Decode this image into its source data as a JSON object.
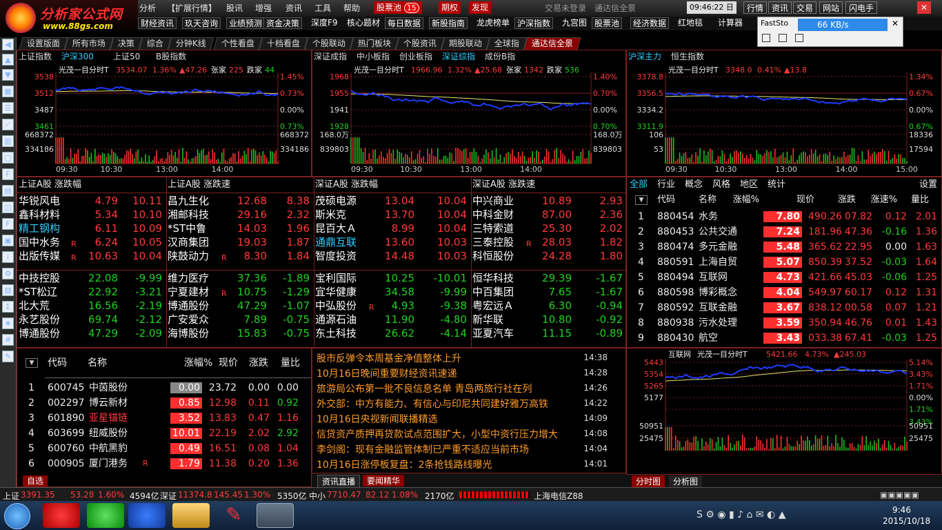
{
  "app": {
    "logo_title": "分析家公式网",
    "logo_url": "www.88gs.com"
  },
  "menu": {
    "items": [
      "分析",
      "【扩展行情】",
      "股讯",
      "增强",
      "资讯",
      "工具",
      "帮助"
    ],
    "stockpool": "股票池",
    "badge": "15",
    "qiquan": "期权",
    "fahuo": "发现",
    "login": "交易未登录",
    "quanjing": "通达信全景",
    "time": "09:46:22 日",
    "right": [
      "行情",
      "资讯",
      "交易",
      "网站",
      "闪电手"
    ]
  },
  "toolbar2": [
    "财经资讯",
    "玖天咨询",
    "业绩预测",
    "资金决策",
    "深度F9",
    "核心题材",
    "每日数据",
    "新股指南",
    "龙虎榜单",
    "沪深指数",
    "九宫图",
    "股票池",
    "经济数据",
    "红地毯",
    "计算器"
  ],
  "popup": {
    "speed": "66 KB/s",
    "app": "FastSto"
  },
  "tabs": [
    "设置版面",
    "所有市场",
    "决策",
    "综合",
    "分钟K线",
    "个性看盘",
    "十档看盘",
    "个股联动",
    "热门板块",
    "个股资讯",
    "期股联动",
    "全球指",
    "通达信全景"
  ],
  "chart1": {
    "subtabs": [
      "上证指数",
      "沪深300",
      "上证50",
      "B股指数"
    ],
    "title": "光茂一目分时T",
    "price": "3534.07",
    "pct": "1.36%",
    "chg": "▲47.26",
    "up_label": "张家",
    "up": "225",
    "down_label": "跌家",
    "down": "44",
    "ylab": [
      "3538",
      "3512",
      "3487",
      "3461",
      "668372",
      "334186"
    ],
    "rlab": [
      "1.45%",
      "0.73%",
      "0.00%",
      "0.73%",
      "668372",
      "334186"
    ],
    "xlab": [
      "09:30",
      "10:30",
      "13:00",
      "14:00"
    ]
  },
  "chart2": {
    "subtabs": [
      "深证成指",
      "中小板指",
      "创业板指",
      "深证综指",
      "成份B指"
    ],
    "title": "光茂一目分时T",
    "price": "1966.96",
    "pct": "1.32%",
    "chg": "▲25.68",
    "up_label": "张家",
    "up": "1342",
    "down_label": "跌家",
    "down": "536",
    "ylab": [
      "1968",
      "1955",
      "1941",
      "1928",
      "168.0万",
      "839803"
    ],
    "rlab": [
      "1.40%",
      "0.70%",
      "0.00%",
      "0.70%",
      "168.0万",
      "839803"
    ],
    "xlab": [
      "09:30",
      "10:30",
      "13:00",
      "14:00"
    ]
  },
  "chart3": {
    "subtabs": [
      "沪深主力",
      "恒生指数"
    ],
    "title": "光茂一目分时T",
    "price": "3348.0",
    "pct": "0.41%",
    "chg": "▲13.8",
    "ylab": [
      "3378.8",
      "3356.5",
      "3334.2",
      "3311.9",
      "106",
      "53"
    ],
    "rlab": [
      "1.34%",
      "0.67%",
      "0.00%",
      "0.67%",
      "18336",
      "17594"
    ],
    "xlab": [
      "09:30",
      "10:30",
      "13:00",
      "14:00",
      "15:00"
    ]
  },
  "chart4": {
    "title": "互联网",
    "sub": "光茂一目分时T",
    "price": "5421.66",
    "pct": "4.73%",
    "chg": "▲245.03",
    "ylab": [
      "5443",
      "5354",
      "5265",
      "5177",
      "",
      "50951",
      "25475"
    ],
    "rlab": [
      "5.14%",
      "3.43%",
      "1.71%",
      "0.00%",
      "1.71%",
      "3.43%",
      "50951",
      "25475"
    ]
  },
  "rank": {
    "headers": [
      "上证A股 涨跌幅",
      "上证A股 涨跌速",
      "深证A股 涨跌幅",
      "深证A股 涨跌速"
    ],
    "cols": [
      {
        "top": [
          [
            "华锐风电",
            "4.79",
            "10.11",
            ""
          ],
          [
            "鑫科材料",
            "5.34",
            "10.10",
            ""
          ],
          [
            "精工钢构",
            "6.11",
            "10.09",
            ""
          ],
          [
            "国中水务",
            "6.24",
            "10.05",
            "R"
          ],
          [
            "出版传媒",
            "10.63",
            "10.04",
            "R"
          ]
        ],
        "bot": [
          [
            "中技控股",
            "22.08",
            "-9.99",
            ""
          ],
          [
            "*ST松辽",
            "22.92",
            "-3.21",
            ""
          ],
          [
            "北大荒",
            "16.56",
            "-2.19",
            ""
          ],
          [
            "永艺股份",
            "69.74",
            "-2.12",
            ""
          ],
          [
            "博通股份",
            "47.29",
            "-2.09",
            ""
          ]
        ]
      },
      {
        "top": [
          [
            "昌九生化",
            "12.68",
            "8.38",
            ""
          ],
          [
            "湘邮科技",
            "29.16",
            "2.32",
            ""
          ],
          [
            "*ST中鲁",
            "14.03",
            "1.96",
            ""
          ],
          [
            "汉商集团",
            "19.03",
            "1.87",
            ""
          ],
          [
            "陕鼓动力",
            "8.30",
            "1.84",
            "R"
          ]
        ],
        "bot": [
          [
            "维力医疗",
            "37.36",
            "-1.89",
            ""
          ],
          [
            "宁夏建材",
            "10.75",
            "-1.29",
            "R"
          ],
          [
            "博通股份",
            "47.29",
            "-1.07",
            ""
          ],
          [
            "广安爱众",
            "7.89",
            "-0.75",
            ""
          ],
          [
            "海博股份",
            "15.83",
            "-0.75",
            ""
          ]
        ]
      },
      {
        "top": [
          [
            "茂硕电源",
            "13.04",
            "10.04",
            ""
          ],
          [
            "斯米克",
            "13.70",
            "10.04",
            ""
          ],
          [
            "昆百大Ａ",
            "8.99",
            "10.04",
            ""
          ],
          [
            "通鼎互联",
            "13.60",
            "10.03",
            ""
          ],
          [
            "智度投资",
            "14.48",
            "10.03",
            ""
          ]
        ],
        "bot": [
          [
            "宝利国际",
            "10.25",
            "-10.01",
            ""
          ],
          [
            "宜华健康",
            "34.58",
            "-9.99",
            ""
          ],
          [
            "中弘股份",
            "4.93",
            "-9.38",
            "R"
          ],
          [
            "通源石油",
            "11.90",
            "-4.80",
            ""
          ],
          [
            "东土科技",
            "26.62",
            "-4.14",
            ""
          ]
        ]
      },
      {
        "top": [
          [
            "中兴商业",
            "10.89",
            "2.93",
            ""
          ],
          [
            "中科金财",
            "87.00",
            "2.36",
            ""
          ],
          [
            "三特索道",
            "25.30",
            "2.02",
            ""
          ],
          [
            "三泰控股",
            "28.03",
            "1.82",
            "R"
          ],
          [
            "科恒股份",
            "24.28",
            "1.80",
            ""
          ]
        ],
        "bot": [
          [
            "恒华科技",
            "29.39",
            "-1.67",
            ""
          ],
          [
            "中百集团",
            "7.65",
            "-1.67",
            ""
          ],
          [
            "粤宏远Ａ",
            "6.30",
            "-0.94",
            ""
          ],
          [
            "新华联",
            "10.80",
            "-0.92",
            ""
          ],
          [
            "亚夏汽车",
            "11.15",
            "-0.89",
            ""
          ]
        ]
      }
    ]
  },
  "sector": {
    "tabs": [
      "全部",
      "行业",
      "概念",
      "风格",
      "地区",
      "统计"
    ],
    "setting": "设置",
    "headers": [
      "代码",
      "名称",
      "涨幅%",
      "现价",
      "涨跌",
      "涨速%",
      "量比"
    ],
    "rows": [
      [
        "1",
        "880454",
        "水务",
        "7.80",
        "490.26",
        "07.82",
        "0.12",
        "2.01"
      ],
      [
        "2",
        "880453",
        "公共交通",
        "7.24",
        "181.96",
        "47.36",
        "-0.16",
        "1.36"
      ],
      [
        "3",
        "880474",
        "多元金融",
        "5.48",
        "365.62",
        "22.95",
        "0.00",
        "1.63"
      ],
      [
        "4",
        "880591",
        "上海自贸",
        "5.07",
        "850.39",
        "37.52",
        "-0.03",
        "1.64"
      ],
      [
        "5",
        "880494",
        "互联网",
        "4.73",
        "421.66",
        "45.03",
        "-0.06",
        "1.25"
      ],
      [
        "6",
        "880598",
        "博彩概念",
        "4.04",
        "549.97",
        "60.17",
        "0.12",
        "1.31"
      ],
      [
        "7",
        "880592",
        "互联金融",
        "3.67",
        "838.12",
        "00.58",
        "0.07",
        "1.21"
      ],
      [
        "8",
        "880938",
        "污水处理",
        "3.59",
        "350.94",
        "46.76",
        "0.01",
        "1.43"
      ],
      [
        "9",
        "880430",
        "航空",
        "3.43",
        "033.38",
        "67.41",
        "-0.03",
        "1.25"
      ]
    ]
  },
  "watch": {
    "headers": [
      "代码",
      "名称",
      "涨幅%",
      "现价",
      "涨跌",
      "量比"
    ],
    "tab": "自选",
    "rows": [
      [
        "1",
        "600745",
        "中茵股份",
        "0.00",
        "23.72",
        "0.00",
        "0.00",
        ""
      ],
      [
        "2",
        "002297",
        "博云新材",
        "0.85",
        "12.98",
        "0.11",
        "0.92",
        ""
      ],
      [
        "3",
        "601890",
        "亚星锚链",
        "3.52",
        "13.83",
        "0.47",
        "1.16",
        ""
      ],
      [
        "4",
        "603699",
        "纽威股份",
        "10.01",
        "22.19",
        "2.02",
        "2.92",
        ""
      ],
      [
        "5",
        "600760",
        "中航黑豹",
        "0.49",
        "16.51",
        "0.08",
        "1.04",
        ""
      ],
      [
        "6",
        "000905",
        "厦门港务",
        "1.79",
        "11.38",
        "0.20",
        "1.36",
        "R"
      ]
    ]
  },
  "news": {
    "tabs": [
      "资讯直播",
      "要闻精华"
    ],
    "items": [
      [
        "股市反弹令本周基金净值整体上升",
        "14:38"
      ],
      [
        "10月16日晚间重要财经资讯速递",
        "14:28"
      ],
      [
        "旅游局公布第一批不良信息名单 青岛两旅行社在列",
        "14:26"
      ],
      [
        "外交部：中方有能力、有信心与印尼共同建好雅万高铁",
        "14:22"
      ],
      [
        "10月16日央视新闻联播精选",
        "14:09"
      ],
      [
        "信贷资产质押再贷款试点范围扩大，小型中资行压力增大",
        "14:08"
      ],
      [
        "李剑阁：现有金融监管体制已严重不适应当前市场",
        "14:04"
      ],
      [
        "10月16日涨停板复盘：2条抢钱路线曝光",
        "14:01"
      ]
    ]
  },
  "bottomtabs": [
    "分时图",
    "分析图"
  ],
  "status": {
    "sh_label": "上证",
    "sh": "3391.35",
    "sh_chg": "53.28",
    "sh_pct": "1.60%",
    "sh_amt": "4594亿",
    "sz_label": "深证",
    "sz": "11374.8",
    "sz_chg": "145.45",
    "sz_pct": "1.30%",
    "sz_amt": "5350亿",
    "zx_label": "中小",
    "zx": "7710.47",
    "zx_chg": "82.12",
    "zx_pct": "1.08%",
    "zx_amt": "2170亿",
    "server": "上海电信Z88"
  },
  "taskbar": {
    "time": "9:46",
    "date": "2015/10/18"
  }
}
